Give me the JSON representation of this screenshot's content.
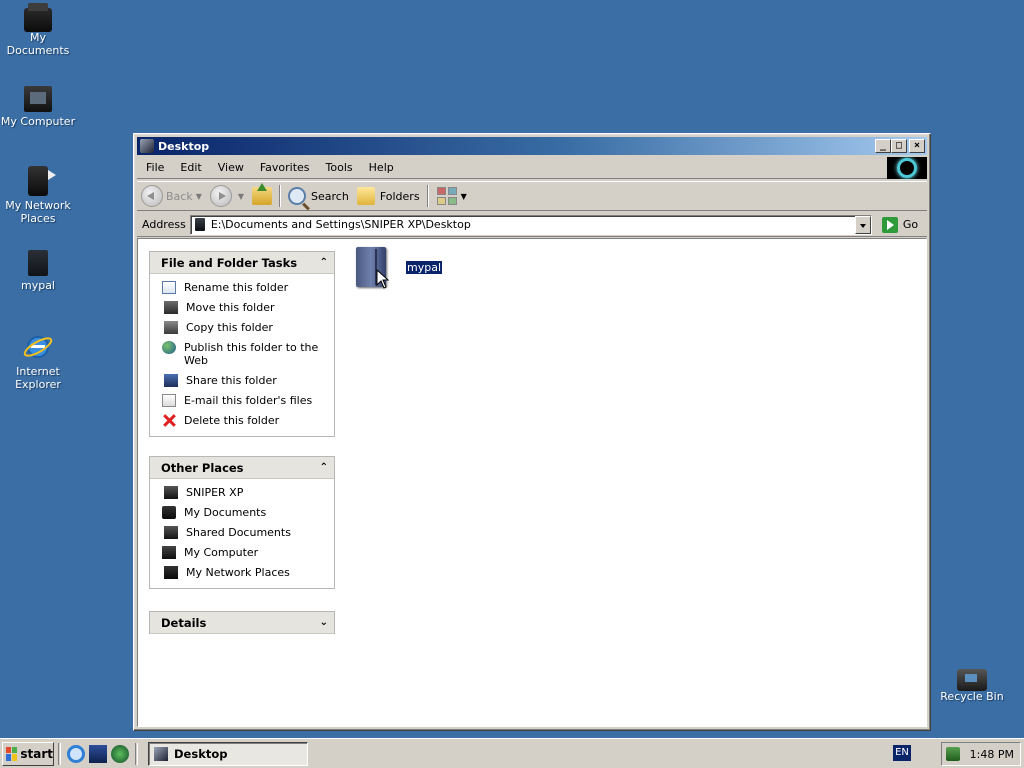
{
  "desktop": {
    "icons": [
      {
        "label": "My Documents"
      },
      {
        "label": "My Computer"
      },
      {
        "label": "My Network Places"
      },
      {
        "label": "mypal"
      },
      {
        "label": "Internet Explorer"
      }
    ],
    "recycle_bin": "Recycle Bin"
  },
  "window": {
    "title": "Desktop",
    "menu": [
      "File",
      "Edit",
      "View",
      "Favorites",
      "Tools",
      "Help"
    ],
    "toolbar": {
      "back": "Back",
      "search": "Search",
      "folders": "Folders"
    },
    "address": {
      "label": "Address",
      "value": "E:\\Documents and Settings\\SNIPER XP\\Desktop",
      "go": "Go"
    },
    "file_folder_tasks": {
      "title": "File and Folder Tasks",
      "items": [
        "Rename this folder",
        "Move this folder",
        "Copy this folder",
        "Publish this folder to the Web",
        "Share this folder",
        "E-mail this folder's files",
        "Delete this folder"
      ]
    },
    "other_places": {
      "title": "Other Places",
      "items": [
        "SNIPER XP",
        "My Documents",
        "Shared Documents",
        "My Computer",
        "My Network Places"
      ]
    },
    "details": {
      "title": "Details"
    },
    "files": [
      {
        "name": "mypal",
        "selected": true
      }
    ]
  },
  "taskbar": {
    "start": "start",
    "active_task": "Desktop",
    "language": "EN",
    "clock": "1:48 PM"
  },
  "colors": {
    "desktop_bg": "#3a6ea5",
    "title_gradient_start": "#0a246a",
    "selection": "#0a246a"
  }
}
